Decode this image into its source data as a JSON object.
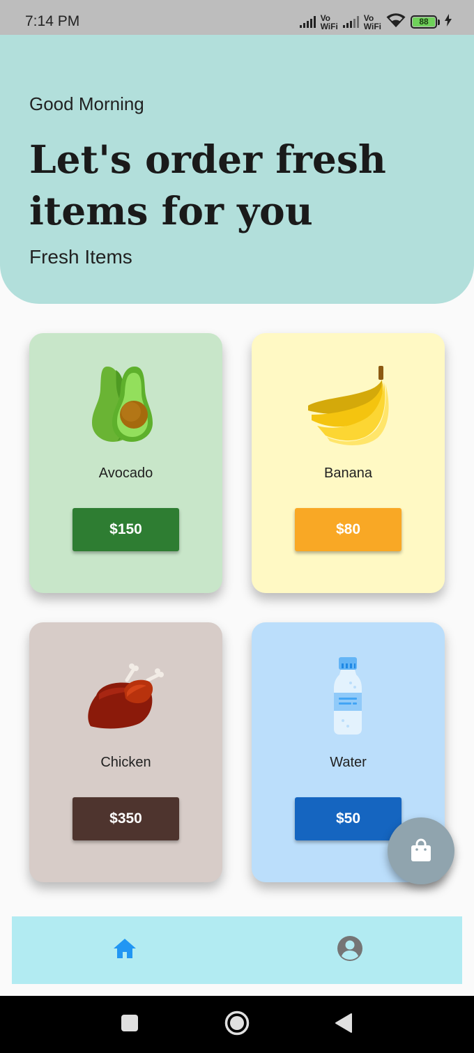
{
  "status_bar": {
    "time": "7:14 PM",
    "vowifi_top": "Vo",
    "vowifi_bottom": "WiFi",
    "battery_level": "88",
    "icons": [
      "signal-icon",
      "vowifi-icon",
      "signal-icon",
      "vowifi-icon",
      "wifi-icon",
      "battery-icon",
      "charging-icon"
    ]
  },
  "header": {
    "greeting": "Good Morning",
    "headline": "Let's order fresh items for you",
    "section_label": "Fresh Items",
    "background_color": "#b2dfdb"
  },
  "items": [
    {
      "name": "Avocado",
      "price": "$150",
      "card_color": "#c8e6c9",
      "button_color": "#2e7d32",
      "icon": "avocado-icon"
    },
    {
      "name": "Banana",
      "price": "$80",
      "card_color": "#fff9c4",
      "button_color": "#f9a825",
      "icon": "banana-icon"
    },
    {
      "name": "Chicken",
      "price": "$350",
      "card_color": "#d7ccc8",
      "button_color": "#4e342e",
      "icon": "chicken-icon"
    },
    {
      "name": "Water",
      "price": "$50",
      "card_color": "#bbdefb",
      "button_color": "#1565c0",
      "icon": "water-bottle-icon"
    }
  ],
  "fab": {
    "icon": "shopping-bag-icon",
    "color": "#90a4ae"
  },
  "bottom_nav": {
    "background_color": "#b2ebf2",
    "items": [
      {
        "icon": "home-icon",
        "active": true,
        "color": "#2196f3"
      },
      {
        "icon": "account-circle-icon",
        "active": false,
        "color": "#757575"
      }
    ]
  },
  "system_nav": {
    "icons": [
      "recents-square-icon",
      "home-circle-icon",
      "back-triangle-icon"
    ]
  }
}
